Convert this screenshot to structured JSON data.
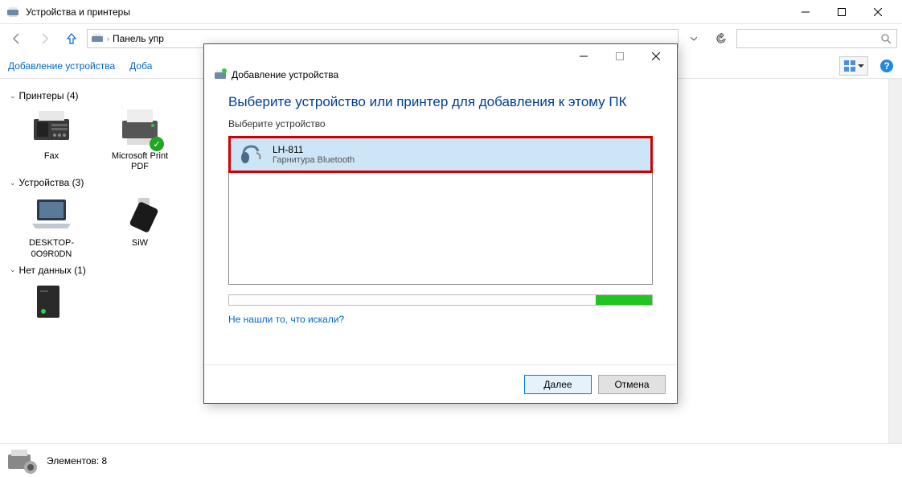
{
  "window": {
    "title": "Устройства и принтеры",
    "breadcrumb": "Панель упр",
    "search_placeholder": ""
  },
  "toolbar": {
    "add_device": "Добавление устройства",
    "add_printer_prefix": "Доба"
  },
  "groups": {
    "printers": {
      "label": "Принтеры (4)"
    },
    "devices": {
      "label": "Устройства (3)"
    },
    "no_data": {
      "label": "Нет данных (1)"
    }
  },
  "items": {
    "fax": "Fax",
    "ms_print_pdf": "Microsoft Print PDF",
    "desktop": "DESKTOP-0O9R0DN",
    "siw": "SiW"
  },
  "status": {
    "elements": "Элементов: 8"
  },
  "dialog": {
    "header": "Добавление устройства",
    "title": "Выберите устройство или принтер для добавления к этому ПК",
    "subtitle": "Выберите устройство",
    "device": {
      "name": "LH-811",
      "sub": "Гарнитура Bluetooth"
    },
    "not_found": "Не нашли то, что искали?",
    "next": "Далее",
    "cancel": "Отмена"
  }
}
